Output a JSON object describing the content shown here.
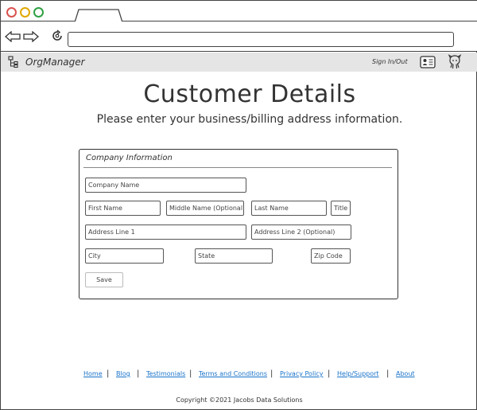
{
  "app": {
    "brand_name": "OrgManager",
    "sign_in_out": "Sign In/Out"
  },
  "page": {
    "title": "Customer Details",
    "subtitle": "Please enter your business/billing address information."
  },
  "form": {
    "section_title": "Company Information",
    "fields": {
      "company_name": "Company Name",
      "first_name": "First Name",
      "middle_name": "Middle Name (Optional)",
      "last_name": "Last Name",
      "title": "Title",
      "address_line_1": "Address Line 1",
      "address_line_2": "Address Line 2 (Optional)",
      "city": "City",
      "state": "State",
      "zip_code": "Zip Code"
    },
    "save_label": "Save"
  },
  "footer": {
    "links": [
      "Home",
      "Blog",
      "Testimonials",
      "Terms and Conditions",
      "Privacy Policy",
      "Help/Support",
      "About"
    ],
    "copyright": "Copyright ©2021 Jacobs Data Solutions"
  },
  "colors": {
    "link": "#1a73c9",
    "appbar_bg": "#e5e5e5",
    "close_dot": "#d9534f",
    "minimize_dot": "#e0a800",
    "maximize_dot": "#2ea043"
  },
  "icons": {
    "brand": "org-tree-icon",
    "profile": "id-card-icon",
    "repo": "octocat-icon",
    "back": "arrow-left-icon",
    "forward": "arrow-right-icon",
    "reload": "reload-icon"
  }
}
